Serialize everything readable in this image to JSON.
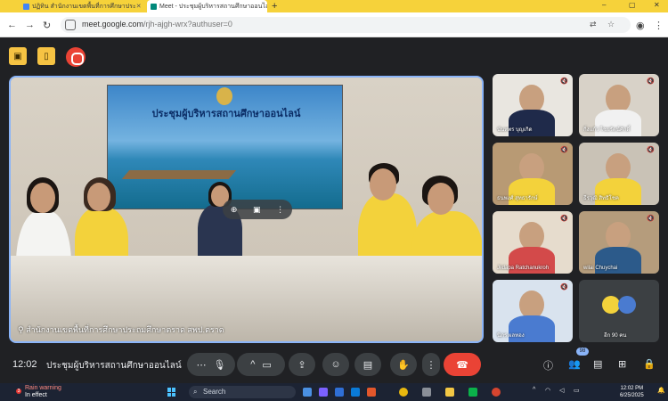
{
  "browser": {
    "tabs": [
      {
        "label": "ปฏิทิน สำนักงานเขตพื้นที่การศึกษาประ",
        "favicon_color": "#4285f4"
      },
      {
        "label": "Meet - ประชุมผู้บริหารสถานศึกษาออนไลน์",
        "favicon_color": "#00897b"
      }
    ],
    "new_tab": "+",
    "window_controls": [
      "–",
      "▢",
      "✕"
    ],
    "url_host": "meet.google.com",
    "url_path": "/rjh-ajgh-wrx?authuser=0"
  },
  "meet": {
    "top_buttons": [
      "host-controls",
      "exit-door",
      "record"
    ],
    "main_video": {
      "banner_title": "ประชุมผู้บริหารสถานศึกษาออนไลน์",
      "speaker_label": "สำนักงานเขตพื้นที่การศึกษาประถมศึกษาตราด สพป.ตราด"
    },
    "participants": [
      {
        "name": "นันทพร บุญเกิด",
        "shirt": "#1f2a4a",
        "bg": "#e9e6e0"
      },
      {
        "name": "กิ่งแก้ว ไชยรัตน์ศักดิ์",
        "shirt": "#f1f1f1",
        "bg": "#d8d2c8"
      },
      {
        "name": "ธนพงศ์ สุทธารักษ์",
        "shirt": "#f3d23b",
        "bg": "#b89a74"
      },
      {
        "name": "ธีรวุฒิ สิทธิโชค",
        "shirt": "#f3d23b",
        "bg": "#c9c2b6"
      },
      {
        "name": "Jiidapa Ratchanukroh",
        "shirt": "#d34a4a",
        "bg": "#e6dccd"
      },
      {
        "name": "wilai Chuychai",
        "shirt": "#2c5a8a",
        "bg": "#b59c7c"
      },
      {
        "name": "นิภร ผลทอง",
        "shirt": "#4a7bd0",
        "bg": "#d9e3ee"
      }
    ],
    "others_label": "อีก 90 คน",
    "clock": "12:02",
    "meeting_name": "ประชุมผู้บริหารสถานศึกษาออนไลน์",
    "people_count": "98",
    "controls": [
      "more",
      "mic",
      "camera-options",
      "camera",
      "present",
      "emoji",
      "captions",
      "raise-hand",
      "more-options",
      "end-call"
    ]
  },
  "taskbar": {
    "weather_badge": "3",
    "weather_line1": "Rain warning",
    "weather_line2": "In effect",
    "search_placeholder": "Search",
    "time": "12:02 PM",
    "date": "6/25/2025"
  }
}
